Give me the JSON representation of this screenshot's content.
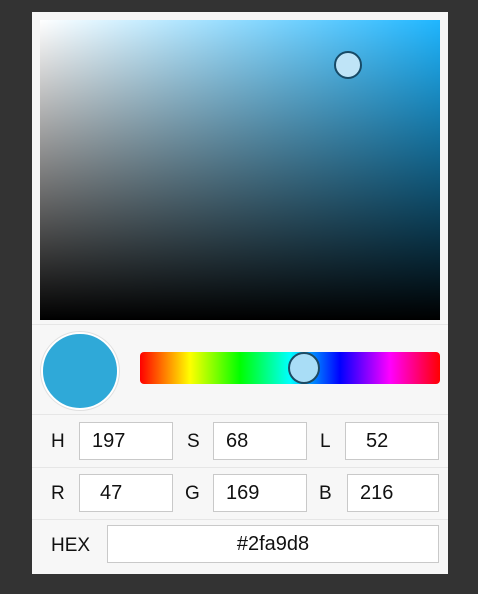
{
  "colors": {
    "background": "#333333",
    "current": "#2fa9d8",
    "hue_base": "#1fb6ff",
    "thumb_fill": "#bfe4f7",
    "hue_thumb_fill": "#a9ddf6"
  },
  "picker": {
    "saturation_fraction": 0.77,
    "value_fraction": 0.85,
    "hue_fraction": 0.547
  },
  "hsl": {
    "h_label": "H",
    "h_value": "197",
    "s_label": "S",
    "s_value": "68",
    "l_label": "L",
    "l_value": "52"
  },
  "rgb": {
    "r_label": "R",
    "r_value": "47",
    "g_label": "G",
    "g_value": "169",
    "b_label": "B",
    "b_value": "216"
  },
  "hex": {
    "label": "HEX",
    "value": "#2fa9d8"
  }
}
